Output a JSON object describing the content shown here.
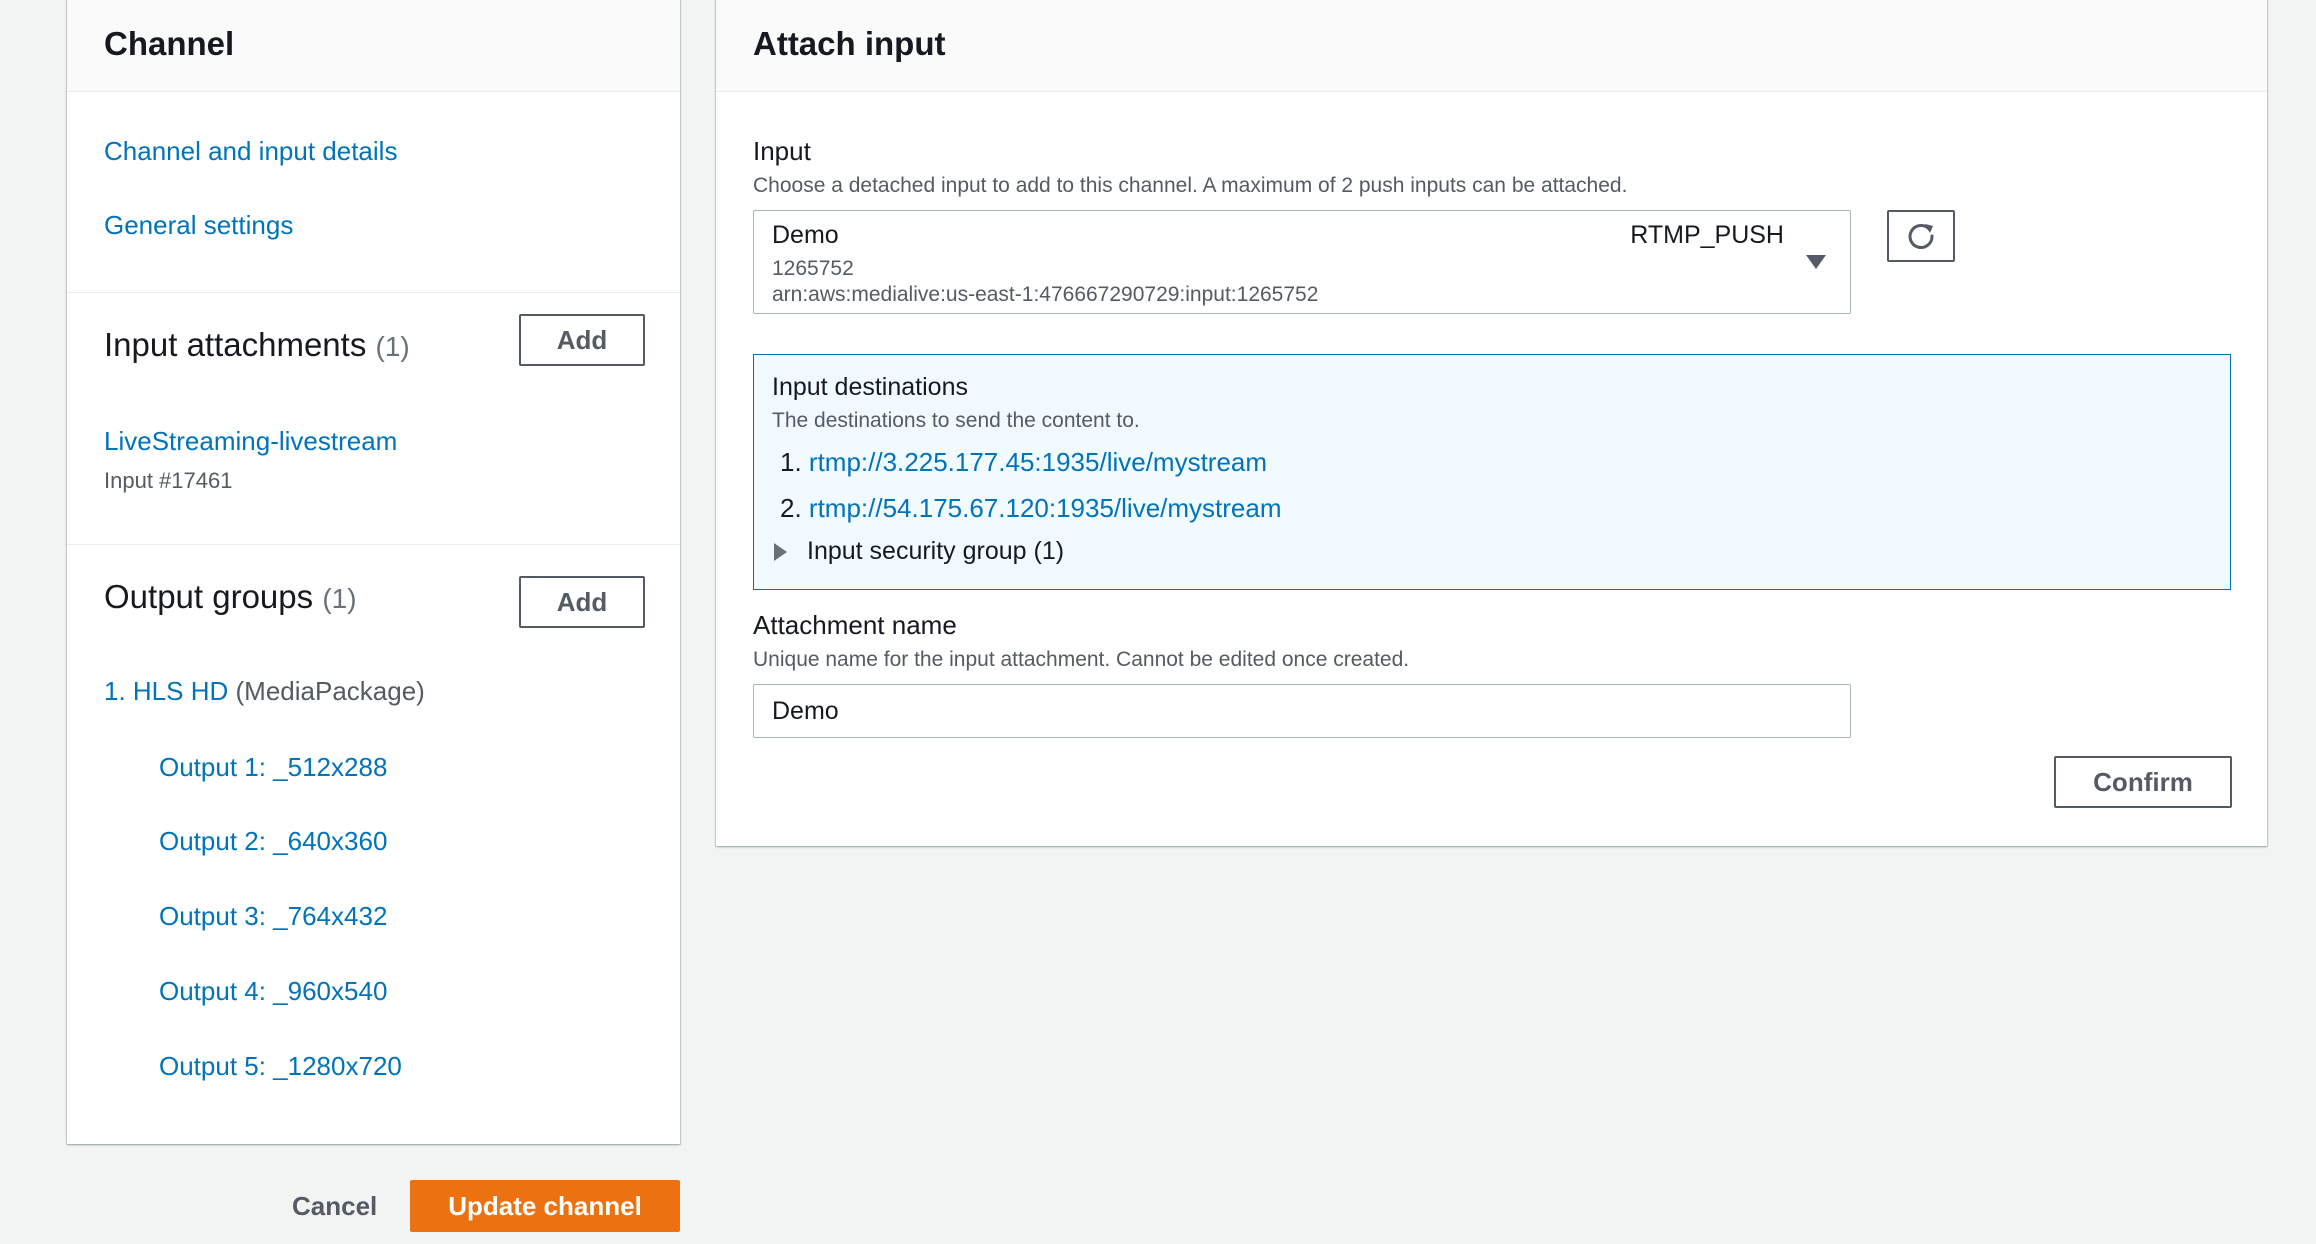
{
  "channel_panel": {
    "title": "Channel",
    "nav": [
      {
        "label": "Channel and input details"
      },
      {
        "label": "General settings"
      }
    ],
    "input_attachments": {
      "title": "Input attachments",
      "count": "(1)",
      "add_label": "Add",
      "items": [
        {
          "name": "LiveStreaming-livestream",
          "sub": "Input #17461"
        }
      ]
    },
    "output_groups": {
      "title": "Output groups",
      "count": "(1)",
      "add_label": "Add",
      "group_label": "1. HLS HD",
      "group_type": "(MediaPackage)",
      "outputs": [
        {
          "label": "Output 1: _512x288"
        },
        {
          "label": "Output 2: _640x360"
        },
        {
          "label": "Output 3: _764x432"
        },
        {
          "label": "Output 4: _960x540"
        },
        {
          "label": "Output 5: _1280x720"
        }
      ]
    }
  },
  "attach_panel": {
    "title": "Attach input",
    "input": {
      "label": "Input",
      "description": "Choose a detached input to add to this channel. A maximum of 2 push inputs can be attached.",
      "selected": {
        "name": "Demo",
        "id": "1265752",
        "arn": "arn:aws:medialive:us-east-1:476667290729:input:1265752",
        "type": "RTMP_PUSH"
      },
      "refresh_icon": "refresh-icon"
    },
    "destinations": {
      "title": "Input destinations",
      "description": "The destinations to send the content to.",
      "items": [
        {
          "num": "1.",
          "url": "rtmp://3.225.177.45:1935/live/mystream"
        },
        {
          "num": "2.",
          "url": "rtmp://54.175.67.120:1935/live/mystream"
        }
      ],
      "security_group_label": "Input security group (1)"
    },
    "attachment_name": {
      "label": "Attachment name",
      "description": "Unique name for the input attachment. Cannot be edited once created.",
      "value": "Demo"
    },
    "confirm_label": "Confirm"
  },
  "footer": {
    "cancel_label": "Cancel",
    "update_label": "Update channel"
  },
  "colors": {
    "link": "#0073bb",
    "primary": "#ec7211",
    "info_bg": "#f1faff",
    "page_bg": "#f2f3f3"
  }
}
